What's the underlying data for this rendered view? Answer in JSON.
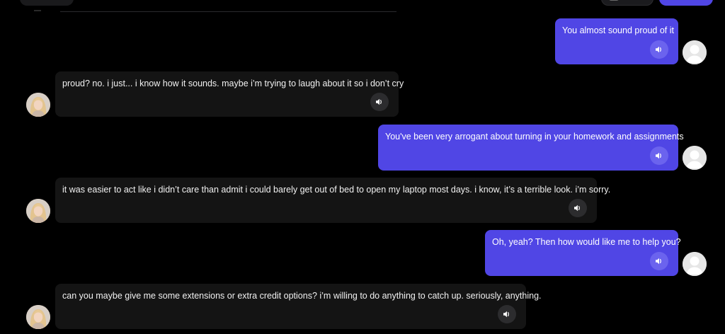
{
  "colors": {
    "background": "#000000",
    "user_bubble": "#5046e5",
    "assistant_bubble": "#141414",
    "user_speaker": "#6b63ee",
    "assistant_speaker": "#2c2c2e"
  },
  "messages": [
    {
      "role": "user",
      "text": "You almost sound proud of it",
      "icon": "speaker-icon"
    },
    {
      "role": "assistant",
      "text": "proud? no. i just... i know how it sounds. maybe i’m trying to laugh about it so i don’t cry",
      "icon": "speaker-icon"
    },
    {
      "role": "user",
      "text": "You've been very arrogant about turning in your homework and assignments",
      "icon": "speaker-icon"
    },
    {
      "role": "assistant",
      "text": "it was easier to act like i didn’t care than admit i could barely get out of bed to open my laptop most days. i know, it’s a terrible look. i’m sorry.",
      "icon": "speaker-icon"
    },
    {
      "role": "user",
      "text": "Oh, yeah? Then how would like me to help you?",
      "icon": "speaker-icon"
    },
    {
      "role": "assistant",
      "text": "can you maybe give me some extensions or extra credit options? i’m willing to do anything to catch up. seriously, anything.",
      "icon": "speaker-icon"
    }
  ]
}
